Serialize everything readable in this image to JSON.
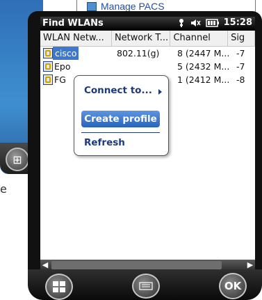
{
  "background": {
    "menu_item_label": "Manage PACS",
    "side_letter": "e"
  },
  "titlebar": {
    "title": "Find WLANs",
    "time": "15:28"
  },
  "table": {
    "columns": [
      "WLAN Netw...",
      "Network T...",
      "Channel",
      "Sig"
    ],
    "rows": [
      {
        "name": "cisco",
        "type": "802.11(g)",
        "channel": "8 (2447 M...",
        "signal": "-7"
      },
      {
        "name": "Epo",
        "type": "",
        "channel": "5 (2432 M...",
        "signal": "-7"
      },
      {
        "name": "FG",
        "type": "",
        "channel": "1 (2412 M...",
        "signal": "-8"
      }
    ]
  },
  "context_menu": {
    "connect_label": "Connect to...",
    "create_label": "Create profile",
    "refresh_label": "Refresh"
  },
  "softkeys": {
    "ok_label": "OK"
  },
  "colors": {
    "selection": "#3d78cc",
    "menu_text": "#1a3a7a",
    "titlebar": "#000000"
  }
}
